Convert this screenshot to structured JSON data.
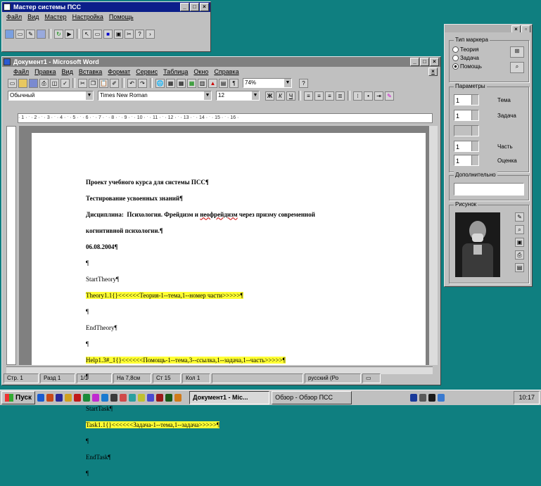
{
  "wizard": {
    "title": "Мастер системы ПСС",
    "menu": [
      "Файл",
      "Вид",
      "Мастер",
      "Настройка",
      "Помощь"
    ]
  },
  "word": {
    "title": "Документ1 - Microsoft Word",
    "menu": [
      "Файл",
      "Правка",
      "Вид",
      "Вставка",
      "Формат",
      "Сервис",
      "Таблица",
      "Окно",
      "Справка"
    ],
    "zoom": "74%",
    "style": "Обычный",
    "font": "Times New Roman",
    "size": "12",
    "document": {
      "line1": "Проект учебного курса для системы ПСС¶",
      "line2": "Тестирование усвоенных знаний¶",
      "line3a": "Дисциплина:  Психология. Фрейдизм и ",
      "line3b": "неофрейдизм",
      "line3c": " через призму современной",
      "line4": "когнитивной психологии.¶",
      "line5": "06.08.2004¶",
      "para1": "¶",
      "start_theory": "StartTheory¶",
      "theory_line": "Theory1.1{}<<<<<<Теория-1--тема,1--номер части>>>>>¶",
      "para2": "¶",
      "end_theory": "EndTheory¶",
      "para3": "¶",
      "help_line": "Help1.3#_1{}<<<<<<Помощь-1--тема,3--ссылка,1--задача,1--часть>>>>>¶",
      "para4": "¶",
      "para5": "¶",
      "start_task": "StartTask¶",
      "task_line": "Task1.1{}<<<<<<Задача-1--тема,1--задача>>>>>¶",
      "para6": "¶",
      "end_task": "EndTask¶",
      "para7": "¶"
    },
    "status": [
      "Стр. 1",
      "Разд 1",
      "1/1",
      "На 7,8см",
      "Ст 15",
      "Кол 1",
      "",
      "русский (Ро"
    ]
  },
  "panel": {
    "group_type": "Тип маркера",
    "radio_theory": "Теория",
    "radio_task": "Задача",
    "radio_help": "Помощь",
    "group_params": "Параметры",
    "label_topic": "Тема",
    "label_task": "Задача",
    "label_part": "Часть",
    "label_score": "Оценка",
    "val_topic": "1",
    "val_task": "1",
    "val_part": "1",
    "val_score": "1",
    "group_extra": "Дополнительно",
    "group_picture": "Рисунок"
  },
  "taskbar": {
    "start": "Пуск",
    "btn_word": "Документ1 - Mic...",
    "btn_folder": "Обзор - Обзор ПСС",
    "clock": "10:17"
  }
}
